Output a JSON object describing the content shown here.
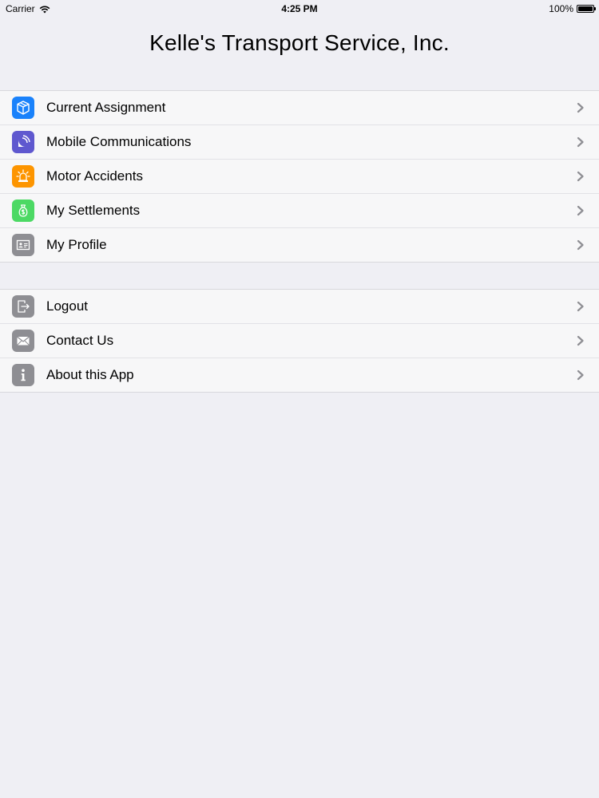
{
  "status_bar": {
    "carrier": "Carrier",
    "time": "4:25 PM",
    "battery_percent": "100%",
    "battery_level": 1.0
  },
  "header": {
    "title": "Kelle's Transport Service, Inc."
  },
  "menu_group_1": [
    {
      "label": "Current Assignment",
      "icon": "box-icon",
      "color": "#1a82fb"
    },
    {
      "label": "Mobile Communications",
      "icon": "satellite-dish-icon",
      "color": "#5f58cf"
    },
    {
      "label": "Motor Accidents",
      "icon": "siren-icon",
      "color": "#fd9500"
    },
    {
      "label": "My Settlements",
      "icon": "money-bag-icon",
      "color": "#4cd964"
    },
    {
      "label": "My Profile",
      "icon": "id-card-icon",
      "color": "#8e8e93"
    }
  ],
  "menu_group_2": [
    {
      "label": "Logout",
      "icon": "logout-icon",
      "color": "#8e8e93"
    },
    {
      "label": "Contact Us",
      "icon": "envelope-icon",
      "color": "#8e8e93"
    },
    {
      "label": "About this App",
      "icon": "info-icon",
      "color": "#8e8e93"
    }
  ],
  "colors": {
    "background": "#efeff4",
    "row_background": "#f7f7f8",
    "chevron": "#8e8e93"
  }
}
